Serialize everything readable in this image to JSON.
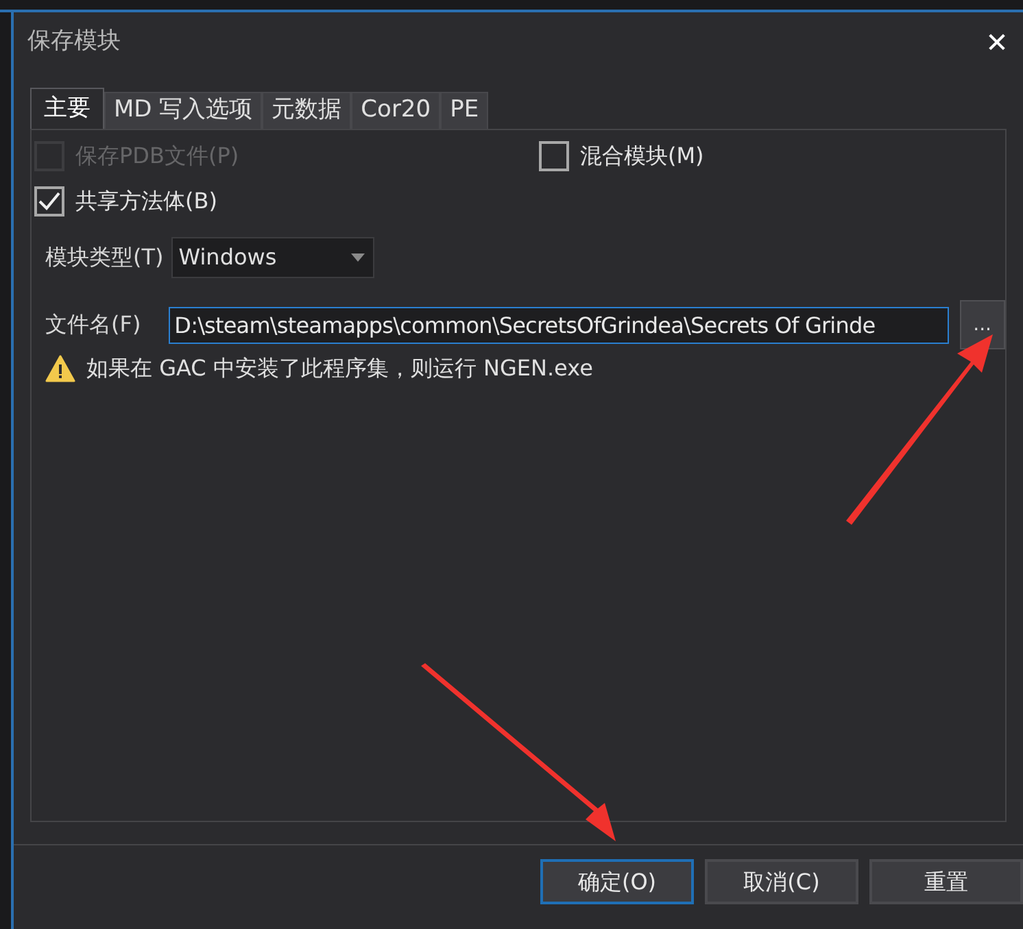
{
  "window": {
    "title": "保存模块",
    "close": "✕"
  },
  "tabs": [
    {
      "label": "主要",
      "selected": true
    },
    {
      "label": "MD 写入选项",
      "selected": false
    },
    {
      "label": "元数据",
      "selected": false
    },
    {
      "label": "Cor20",
      "selected": false
    },
    {
      "label": "PE",
      "selected": false
    }
  ],
  "options": [
    {
      "label": "保存PDB文件(P)",
      "checked": false,
      "disabled": true
    },
    {
      "label": "混合模块(M)",
      "checked": false,
      "disabled": false
    },
    {
      "label": "共享方法体(B)",
      "checked": true,
      "disabled": false
    }
  ],
  "module_type": {
    "label": "模块类型(T)",
    "value": "Windows"
  },
  "file_name": {
    "label": "文件名(F)",
    "value": "D:\\steam\\steamapps\\common\\SecretsOfGrindea\\Secrets Of Grinde",
    "browse": "..."
  },
  "warning": "如果在 GAC 中安装了此程序集，则运行 NGEN.exe",
  "buttons": [
    {
      "label": "确定(O)",
      "default": true
    },
    {
      "label": "取消(C)",
      "default": false
    },
    {
      "label": "重置",
      "default": false
    }
  ]
}
